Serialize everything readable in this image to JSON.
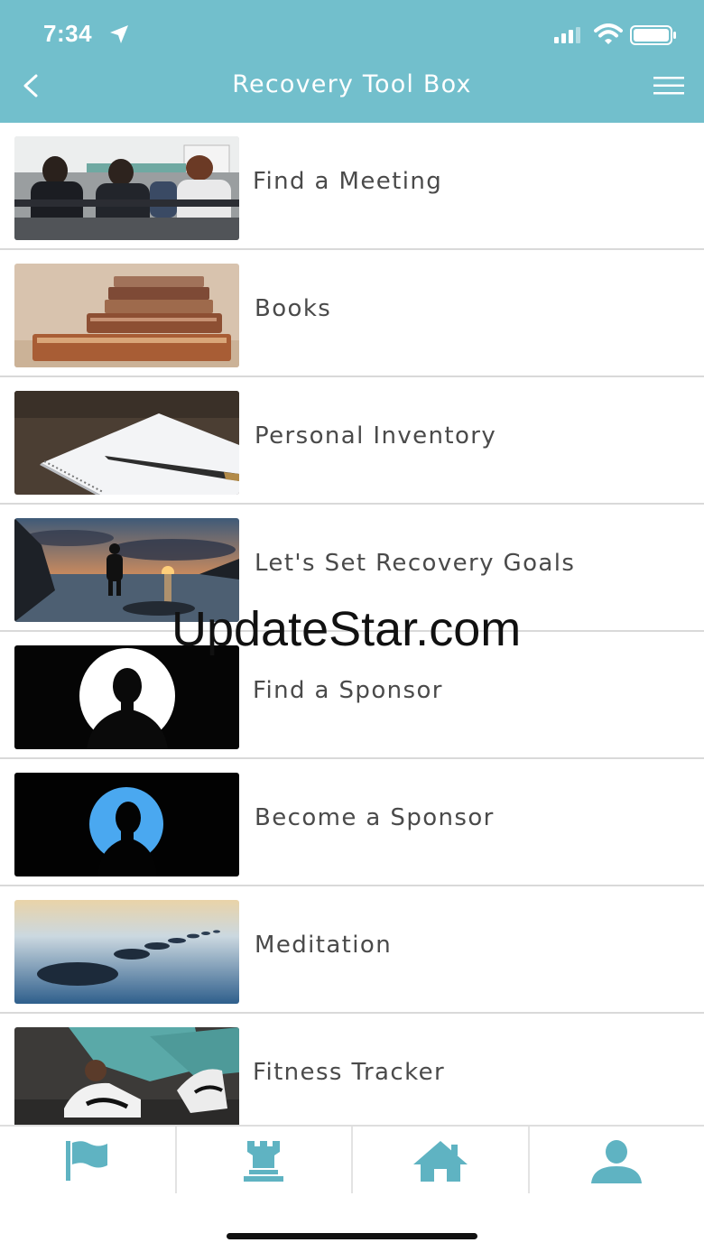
{
  "status_bar": {
    "time": "7:34"
  },
  "header": {
    "title": "Recovery Tool Box"
  },
  "items": [
    {
      "label": "Find a Meeting"
    },
    {
      "label": "Books"
    },
    {
      "label": "Personal Inventory"
    },
    {
      "label": "Let's Set Recovery Goals"
    },
    {
      "label": "Find a Sponsor"
    },
    {
      "label": "Become a Sponsor"
    },
    {
      "label": "Meditation"
    },
    {
      "label": "Fitness Tracker"
    }
  ],
  "watermark": "UpdateStar.com",
  "tabs": [
    {
      "icon": "flag-icon"
    },
    {
      "icon": "tower-icon"
    },
    {
      "icon": "home-icon"
    },
    {
      "icon": "person-icon"
    }
  ],
  "colors": {
    "header": "#72bfcc",
    "tab_icon": "#5fb3c2",
    "divider": "#d9d9d9"
  }
}
